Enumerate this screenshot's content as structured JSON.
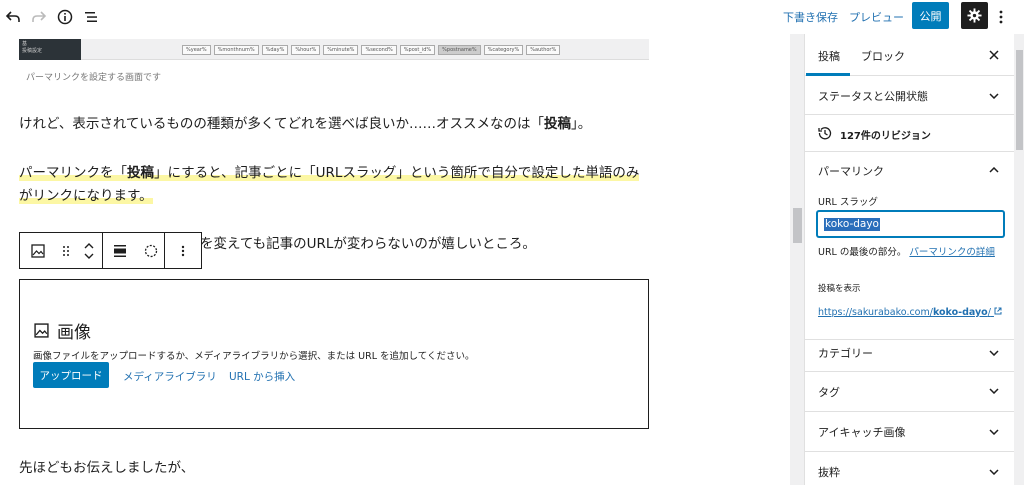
{
  "toolbar": {
    "undo_icon": "undo-icon",
    "redo_icon": "redo-icon",
    "info_icon": "info-icon",
    "outline_icon": "list-view-icon",
    "save_draft": "下書き保存",
    "preview": "プレビュー",
    "publish": "公開",
    "settings_icon": "gear-icon",
    "more_icon": "more-vertical-icon"
  },
  "editor": {
    "image_strip": {
      "left_text": "基\n投稿設定",
      "tags": [
        "%year%",
        "%monthnum%",
        "%day%",
        "%hour%",
        "%minute%",
        "%second%",
        "%post_id%",
        "%postname%",
        "%category%",
        "%author%"
      ],
      "selected_tag": "%postname%"
    },
    "caption": "パーマリンクを設定する画面です",
    "para1": {
      "before": "けれど、表示されているものの種類が多くてどれを選べば良いか……オススメなのは「",
      "bold": "投稿",
      "after": "」。"
    },
    "para2": {
      "line1_before": "パーマリンクを「",
      "line1_bold": "投稿",
      "line1_after": "」にすると、記事ごとに「URLスラッグ」という箇所で自分で設定した単語のみ",
      "line2": "がリンクになります。"
    },
    "para3_visible": "を変えても記事のURLが変わらないのが嬉しいところ。",
    "block_toolbar": {
      "icons": [
        "image-icon",
        "drag-handle-icon",
        "move-up-down-icon",
        "align-icon",
        "circle-dashed-icon",
        "more-vertical-icon"
      ]
    },
    "image_placeholder": {
      "title": "画像",
      "description": "画像ファイルをアップロードするか、メディアライブラリから選択、または URL を追加してください。",
      "upload": "アップロード",
      "media_library": "メディアライブラリ",
      "insert_url": "URL から挿入"
    },
    "para4": "先ほどもお伝えしましたが、"
  },
  "sidebar": {
    "tabs": [
      "投稿",
      "ブロック"
    ],
    "active_tab": "投稿",
    "close_icon": "close-icon",
    "status_panel": "ステータスと公開状態",
    "revisions": "127件のリビジョン",
    "permalink_panel": "パーマリンク",
    "url_slug_label": "URL スラッグ",
    "url_slug_value": "koko-dayo",
    "slug_note_prefix": "URL の最後の部分。",
    "slug_note_link": "パーマリンクの詳細",
    "view_post_label": "投稿を表示",
    "post_url_prefix": "https://sakurabako.com/",
    "post_url_slug": "koko-dayo",
    "post_url_suffix": "/",
    "category_panel": "カテゴリー",
    "tag_panel": "タグ",
    "featured_image_panel": "アイキャッチ画像",
    "excerpt_panel": "抜粋"
  },
  "colors": {
    "accent": "#007cba",
    "link": "#2271b1",
    "highlight": "#fcf7a4",
    "dark": "#1e1e1e"
  }
}
